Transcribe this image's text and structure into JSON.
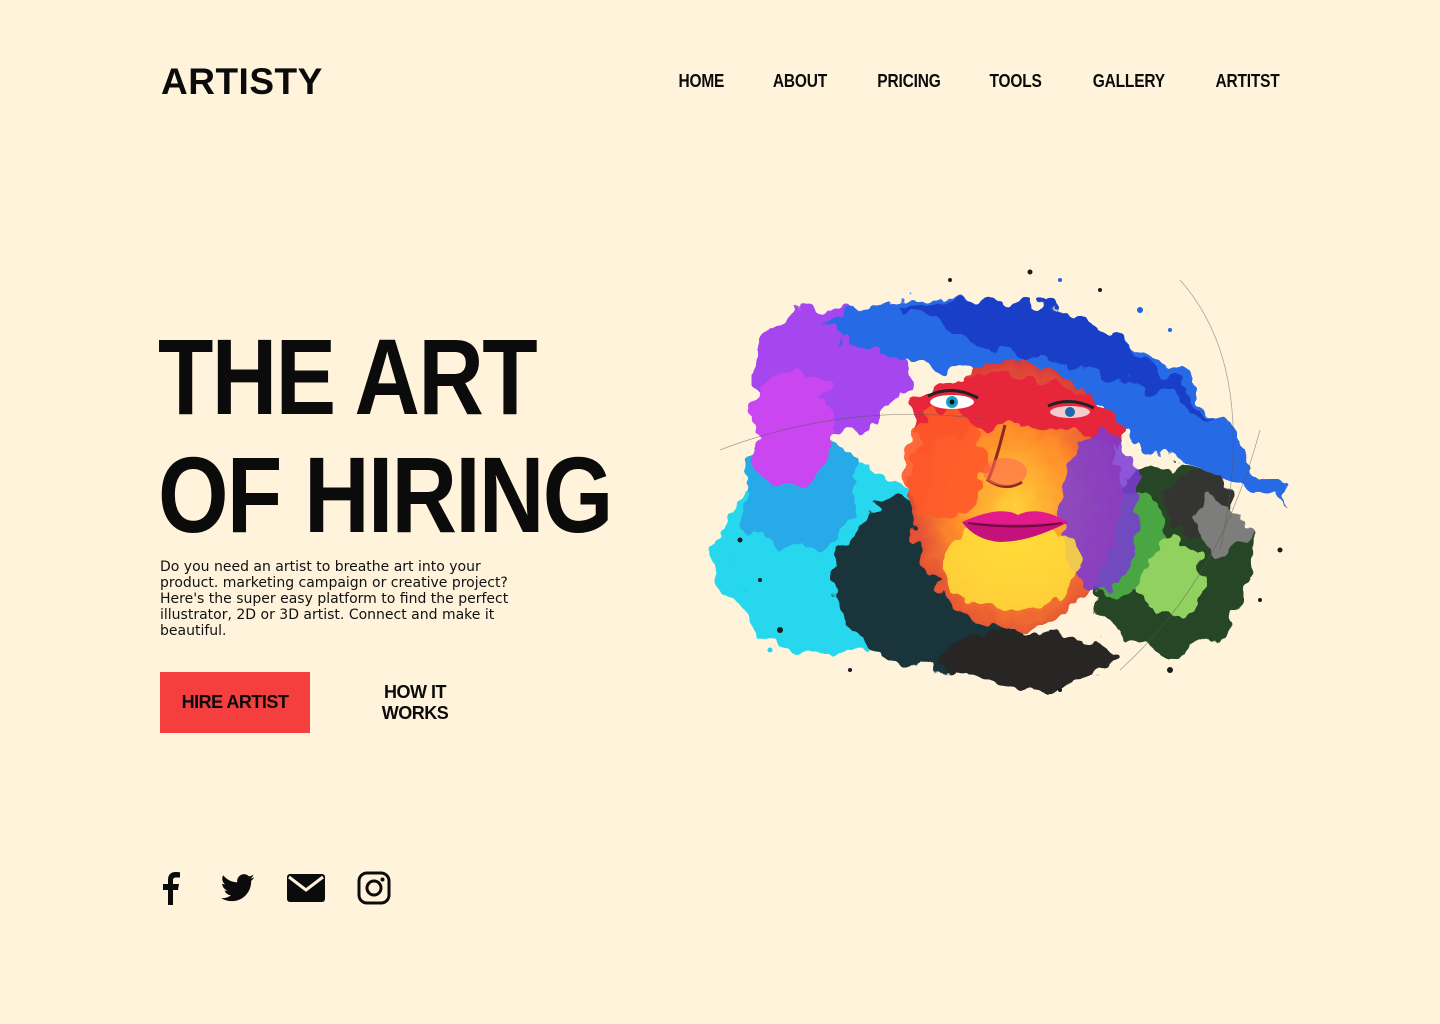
{
  "brand": {
    "logo": "ARTISTY"
  },
  "nav": {
    "items": [
      {
        "label": "HOME"
      },
      {
        "label": "ABOUT"
      },
      {
        "label": "PRICING"
      },
      {
        "label": "TOOLS"
      },
      {
        "label": "GALLERY"
      },
      {
        "label": "ARTITST"
      }
    ]
  },
  "hero": {
    "title_line1": "THE ART",
    "title_line2": "OF HIRING",
    "description": "Do you need an artist to breathe art into your product. marketing campaign or creative project? Here's the super easy platform to find the perfect illustrator, 2D or 3D artist. Connect and make it beautiful.",
    "primary_button": "HIRE ARTIST",
    "secondary_button": "HOW IT WORKS",
    "image": "colorful-splash-portrait"
  },
  "social": {
    "icons": [
      "facebook-icon",
      "twitter-icon",
      "email-icon",
      "instagram-icon"
    ]
  },
  "colors": {
    "background": "#FFF4DB",
    "accent": "#F53E3E",
    "text": "#0B0B0B"
  }
}
